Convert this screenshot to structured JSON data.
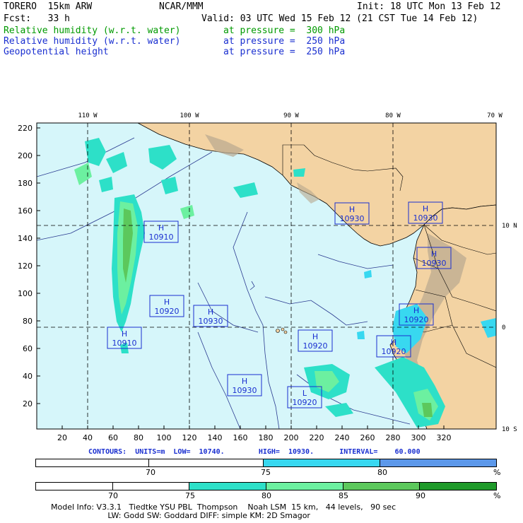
{
  "header": {
    "model": "TORERO  15km ARW",
    "center": "NCAR/MMM",
    "init": "Init: 18 UTC Mon 13 Feb 12",
    "fcst": "Fcst:   33 h",
    "valid": "Valid: 03 UTC Wed 15 Feb 12 (21 CST Tue 14 Feb 12)",
    "fields": [
      {
        "name": "Relative humidity (w.r.t. water)",
        "level": "at pressure =  300 hPa",
        "color": "#009a00"
      },
      {
        "name": "Relative humidity (w.r.t. water)",
        "level": "at pressure =  250 hPa",
        "color": "#1a2fd0"
      },
      {
        "name": "Geopotential height",
        "level": "at pressure =  250 hPa",
        "color": "#1a2fd0"
      }
    ]
  },
  "map": {
    "lon_labels": [
      "110 W",
      "100 W",
      "90 W",
      "80 W",
      "70 W"
    ],
    "lat_labels": [
      "10 N",
      "0",
      "10 S"
    ],
    "x_ticks": [
      "20",
      "40",
      "60",
      "80",
      "100",
      "120",
      "140",
      "160",
      "180",
      "200",
      "220",
      "240",
      "260",
      "280",
      "300",
      "320"
    ],
    "y_ticks": [
      "220",
      "200",
      "180",
      "160",
      "140",
      "120",
      "100",
      "80",
      "60",
      "40",
      "20"
    ],
    "ocean_color": "#d6f6fa",
    "land_color": "#f3d3a3",
    "highs_lows": [
      {
        "type": "H",
        "value": "10930"
      },
      {
        "type": "H",
        "value": "10930"
      },
      {
        "type": "H",
        "value": "10910"
      },
      {
        "type": "H",
        "value": "10930"
      },
      {
        "type": "H",
        "value": "10920"
      },
      {
        "type": "H",
        "value": "10930"
      },
      {
        "type": "H",
        "value": "10920"
      },
      {
        "type": "H",
        "value": "10910"
      },
      {
        "type": "H",
        "value": "10920"
      },
      {
        "type": "H",
        "value": "10920"
      },
      {
        "type": "H",
        "value": "10930"
      },
      {
        "type": "L",
        "value": "10920"
      }
    ]
  },
  "contours": {
    "text": "CONTOURS:  UNITS=m  LOW=  10740.        HIGH=  10930.      INTERVAL=    60.000"
  },
  "colorbar_250": {
    "labels": [
      "70",
      "75",
      "80",
      "%"
    ],
    "colors": [
      "#ffffff",
      "#ffffff",
      "#38d8f0",
      "#5c98ea"
    ]
  },
  "colorbar_300": {
    "labels": [
      "70",
      "75",
      "80",
      "85",
      "90",
      "%"
    ],
    "colors": [
      "#ffffff",
      "#ffffff",
      "#2de0c8",
      "#6cf0a0",
      "#5cc85c",
      "#1f9a2a"
    ]
  },
  "footer": {
    "line1": "Model Info: V3.3.1   Tiedtke YSU PBL  Thompson    Noah LSM  15 km,   44 levels,   90 sec",
    "line2": "                       LW: Godd SW: Goddard DIFF: simple KM: 2D Smagor"
  }
}
